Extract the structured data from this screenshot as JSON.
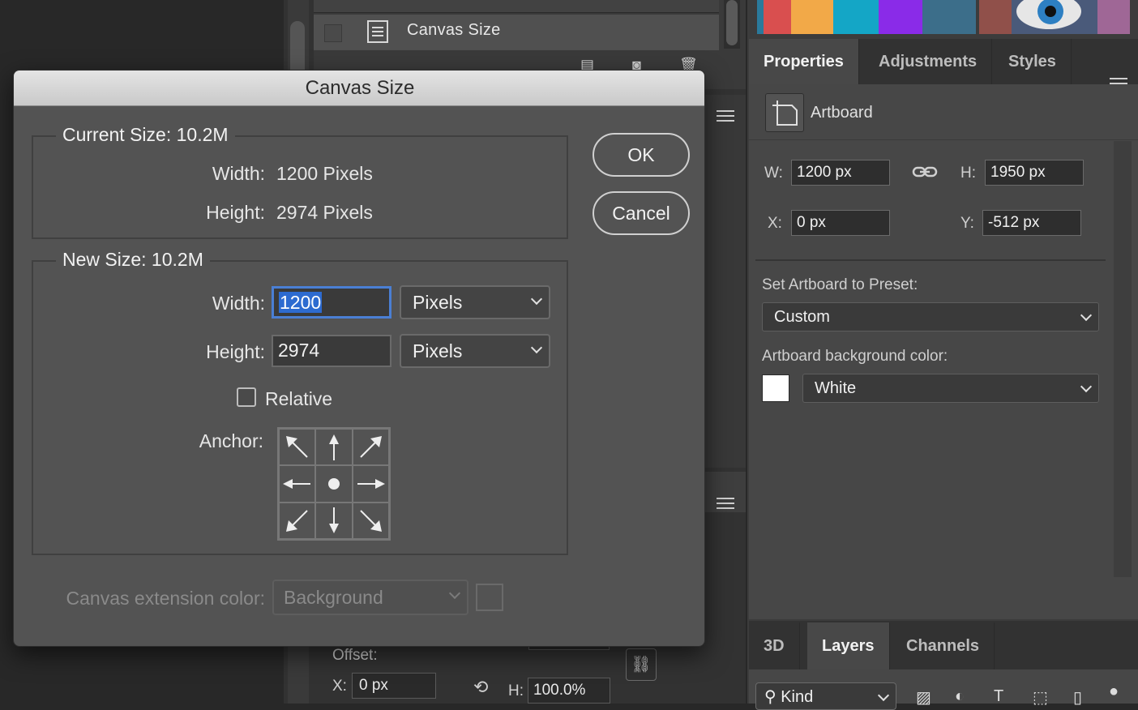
{
  "history": {
    "active_item": "Canvas Size"
  },
  "dialog": {
    "title": "Canvas Size",
    "current_size": {
      "title": "Current Size: 10.2M",
      "width_label": "Width:",
      "width_value": "1200 Pixels",
      "height_label": "Height:",
      "height_value": "2974 Pixels"
    },
    "new_size": {
      "title": "New Size: 10.2M",
      "width_label": "Width:",
      "width_value": "1200",
      "width_unit": "Pixels",
      "height_label": "Height:",
      "height_value": "2974",
      "height_unit": "Pixels",
      "relative_label": "Relative",
      "relative_checked": false,
      "anchor_label": "Anchor:",
      "anchor_selected": "center"
    },
    "extension_color_label": "Canvas extension color:",
    "extension_color_value": "Background",
    "ok_label": "OK",
    "cancel_label": "Cancel"
  },
  "offset": {
    "label": "Offset:",
    "x_label": "X:",
    "x_value": "0 px",
    "h_label": "H:",
    "h_value": "100.0%"
  },
  "properties": {
    "tabs": [
      "Properties",
      "Adjustments",
      "Styles"
    ],
    "active_tab": "Properties",
    "section_label": "Artboard",
    "w_label": "W:",
    "w_value": "1200 px",
    "h_label": "H:",
    "h_value": "1950 px",
    "x_label": "X:",
    "x_value": "0 px",
    "y_label": "Y:",
    "y_value": "-512 px",
    "preset_label": "Set Artboard to Preset:",
    "preset_value": "Custom",
    "bg_color_label": "Artboard background color:",
    "bg_color_value": "White"
  },
  "layers": {
    "tabs": [
      "3D",
      "Layers",
      "Channels"
    ],
    "active_tab": "Layers",
    "filter_value": "Kind"
  },
  "colors": {
    "accent": "#2d6bd0",
    "dialog_bg": "#535353",
    "panel_bg": "#474747"
  }
}
